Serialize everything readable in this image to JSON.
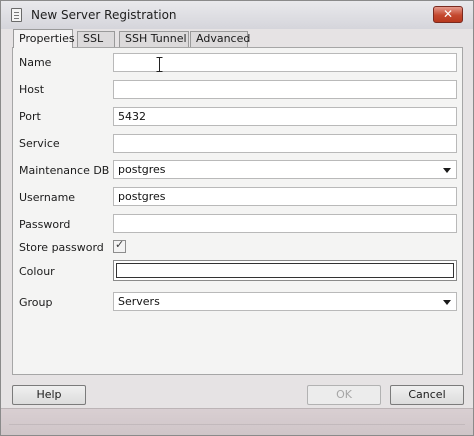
{
  "window": {
    "title": "New Server Registration",
    "close_label": "✕"
  },
  "tabs": [
    {
      "label": "Properties",
      "active": true
    },
    {
      "label": "SSL",
      "active": false
    },
    {
      "label": "SSH Tunnel",
      "active": false
    },
    {
      "label": "Advanced",
      "active": false
    }
  ],
  "form": {
    "name": {
      "label": "Name",
      "value": ""
    },
    "host": {
      "label": "Host",
      "value": ""
    },
    "port": {
      "label": "Port",
      "value": "5432"
    },
    "service": {
      "label": "Service",
      "value": ""
    },
    "maintenance_db": {
      "label": "Maintenance DB",
      "value": "postgres"
    },
    "username": {
      "label": "Username",
      "value": "postgres"
    },
    "password": {
      "label": "Password",
      "value": ""
    },
    "store_password": {
      "label": "Store password",
      "checked": true,
      "check_glyph": "✓"
    },
    "colour": {
      "label": "Colour",
      "value": "#ffffff"
    },
    "group": {
      "label": "Group",
      "value": "Servers"
    }
  },
  "buttons": {
    "help": "Help",
    "ok": "OK",
    "cancel": "Cancel"
  }
}
